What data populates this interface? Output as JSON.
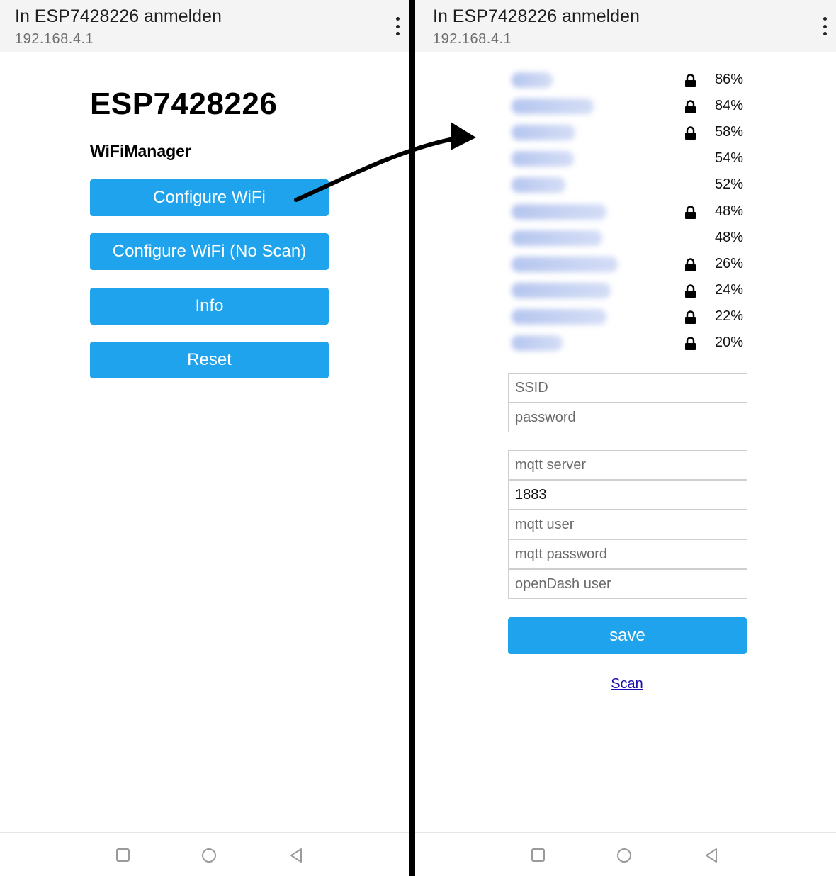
{
  "left": {
    "header": {
      "title": "In ESP7428226 anmelden",
      "url": "192.168.4.1"
    },
    "page": {
      "title": "ESP7428226",
      "subtitle": "WiFiManager"
    },
    "buttons": [
      {
        "label": "Configure WiFi"
      },
      {
        "label": "Configure WiFi (No Scan)"
      },
      {
        "label": "Info"
      },
      {
        "label": "Reset"
      }
    ]
  },
  "right": {
    "header": {
      "title": "In ESP7428226 anmelden",
      "url": "192.168.4.1"
    },
    "networks": [
      {
        "quality": "86%",
        "secured": true
      },
      {
        "quality": "84%",
        "secured": true
      },
      {
        "quality": "58%",
        "secured": true
      },
      {
        "quality": "54%",
        "secured": false
      },
      {
        "quality": "52%",
        "secured": false
      },
      {
        "quality": "48%",
        "secured": true
      },
      {
        "quality": "48%",
        "secured": false
      },
      {
        "quality": "26%",
        "secured": true
      },
      {
        "quality": "24%",
        "secured": true
      },
      {
        "quality": "22%",
        "secured": true
      },
      {
        "quality": "20%",
        "secured": true
      }
    ],
    "wifi_form": {
      "ssid_placeholder": "SSID",
      "password_placeholder": "password"
    },
    "mqtt_form": {
      "server_placeholder": "mqtt server",
      "port_value": "1883",
      "user_placeholder": "mqtt user",
      "password_placeholder": "mqtt password",
      "opendash_placeholder": "openDash user"
    },
    "save_label": "save",
    "scan_label": "Scan"
  },
  "colors": {
    "button": "#1fa3ec",
    "topbar": "#f4f4f4",
    "link": "#1a0dab"
  },
  "icons": [
    "more-vert-icon",
    "lock-icon",
    "nav-square-icon",
    "nav-home-icon",
    "nav-back-icon",
    "arrow-icon"
  ]
}
